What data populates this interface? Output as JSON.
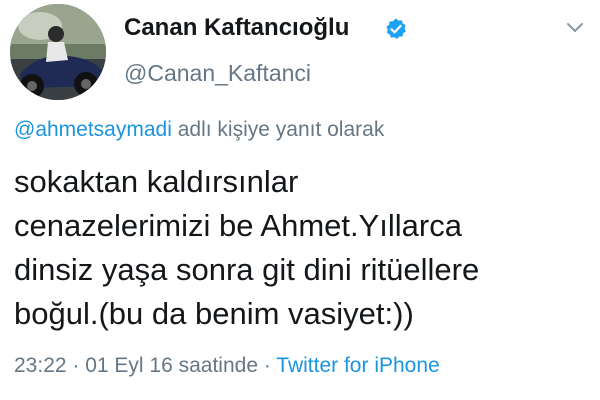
{
  "author": {
    "display_name": "Canan Kaftancıoğlu",
    "handle": "@Canan_Kaftanci",
    "verified_icon": "verified-badge-icon",
    "accent_color": "#1da1f2"
  },
  "reply": {
    "mention": "@ahmetsaymadi",
    "suffix": " adlı kişiye yanıt olarak"
  },
  "tweet": {
    "lines": [
      "sokaktan kaldırsınlar",
      "cenazelerimizi be Ahmet.Yıllarca",
      "dinsiz yaşa sonra git dini ritüellere",
      "boğul.(bu da benim vasiyet:))"
    ]
  },
  "meta": {
    "timestamp": "23:22 · 01 Eyl 16 saatinde · ",
    "source": "Twitter for iPhone"
  },
  "colors": {
    "text": "#14171a",
    "secondary": "#657786",
    "link": "#1b95e0"
  }
}
